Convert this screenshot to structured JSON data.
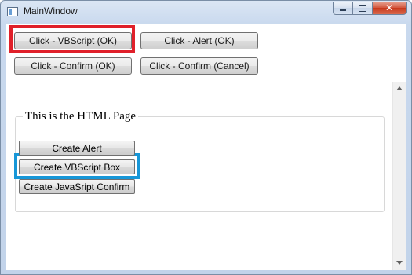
{
  "window": {
    "title": "MainWindow",
    "caption_buttons": {
      "minimize": "",
      "maximize": "",
      "close": "✕"
    }
  },
  "toolbar": {
    "buttons": [
      {
        "label": "Click - VBScript (OK)",
        "highlighted": true,
        "highlight_color": "#e0202a"
      },
      {
        "label": "Click - Alert (OK)",
        "highlighted": false
      },
      {
        "label": "Click - Confirm (OK)",
        "highlighted": false
      },
      {
        "label": "Click - Confirm (Cancel)",
        "highlighted": false
      }
    ]
  },
  "browser": {
    "fieldset_legend": "This is the HTML Page",
    "buttons": [
      {
        "label": "Create Alert",
        "highlighted": false
      },
      {
        "label": "Create VBScript Box",
        "highlighted": true,
        "highlight_color": "#1797d8"
      },
      {
        "label": "Create JavaSript Confirm",
        "highlighted": false
      }
    ],
    "scrollbar": {
      "up_icon": "arrow-up-icon",
      "down_icon": "arrow-down-icon"
    }
  }
}
